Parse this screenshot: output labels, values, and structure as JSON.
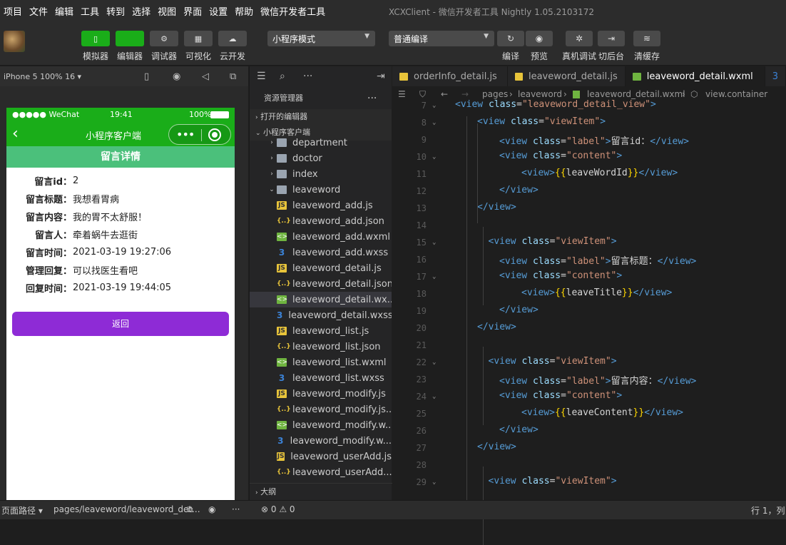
{
  "menu": [
    "项目",
    "文件",
    "编辑",
    "工具",
    "转到",
    "选择",
    "视图",
    "界面",
    "设置",
    "帮助",
    "微信开发者工具"
  ],
  "window_title": "XCXClient - 微信开发者工具 Nightly 1.05.2103172",
  "toolbar": {
    "left_buttons": [
      {
        "label": "模拟器",
        "icon": "phone-icon",
        "active": true
      },
      {
        "label": "编辑器",
        "icon": "code-icon",
        "active": true
      },
      {
        "label": "调试器",
        "icon": "debug-icon",
        "active": false
      },
      {
        "label": "可视化",
        "icon": "layout-icon",
        "active": false
      },
      {
        "label": "云开发",
        "icon": "cloud-icon",
        "active": false
      }
    ],
    "mode_select": "小程序模式",
    "compile_select": "普通编译",
    "right_buttons": [
      {
        "label": "编译",
        "icon": "refresh-icon"
      },
      {
        "label": "预览",
        "icon": "eye-icon"
      },
      {
        "label": "真机调试",
        "icon": "bug-icon"
      },
      {
        "label": "切后台",
        "icon": "switch-icon"
      },
      {
        "label": "清缓存",
        "icon": "layers-icon"
      }
    ]
  },
  "simulator": {
    "device": "iPhone 5 100% 16 ▾",
    "status_left": "●●●●● WeChat",
    "status_time": "19:41",
    "status_battery": "100%",
    "nav_title": "小程序客户端",
    "sub_title": "留言详情",
    "fields": [
      {
        "key": "留言id：",
        "value": "2"
      },
      {
        "key": "留言标题：",
        "value": "我想看胃病"
      },
      {
        "key": "留言内容：",
        "value": "我的胃不太舒服！"
      },
      {
        "key": "留言人：",
        "value": "牵着蜗牛去逛街"
      },
      {
        "key": "留言时间：",
        "value": "2021-03-19 19:27:06"
      },
      {
        "key": "管理回复：",
        "value": "可以找医生看吧"
      },
      {
        "key": "回复时间：",
        "value": "2021-03-19 19:44:05"
      }
    ],
    "back_button": "返回"
  },
  "explorer": {
    "title": "资源管理器",
    "more": "···",
    "open_editors": "打开的编辑器",
    "project": "小程序客户端",
    "items": [
      {
        "name": "department",
        "type": "folder",
        "indent": 1,
        "arrow": "›"
      },
      {
        "name": "doctor",
        "type": "folder",
        "indent": 1,
        "arrow": "›"
      },
      {
        "name": "index",
        "type": "folder",
        "indent": 1,
        "arrow": "›"
      },
      {
        "name": "leaveword",
        "type": "folder",
        "indent": 1,
        "arrow": "⌄"
      },
      {
        "name": "leaveword_add.js",
        "type": "js",
        "indent": 2
      },
      {
        "name": "leaveword_add.json",
        "type": "json",
        "indent": 2
      },
      {
        "name": "leaveword_add.wxml",
        "type": "wxml",
        "indent": 2
      },
      {
        "name": "leaveword_add.wxss",
        "type": "wxss",
        "indent": 2
      },
      {
        "name": "leaveword_detail.js",
        "type": "js",
        "indent": 2
      },
      {
        "name": "leaveword_detail.json",
        "type": "json",
        "indent": 2
      },
      {
        "name": "leaveword_detail.wx...",
        "type": "wxml",
        "indent": 2,
        "selected": true
      },
      {
        "name": "leaveword_detail.wxss",
        "type": "wxss",
        "indent": 2
      },
      {
        "name": "leaveword_list.js",
        "type": "js",
        "indent": 2
      },
      {
        "name": "leaveword_list.json",
        "type": "json",
        "indent": 2
      },
      {
        "name": "leaveword_list.wxml",
        "type": "wxml",
        "indent": 2
      },
      {
        "name": "leaveword_list.wxss",
        "type": "wxss",
        "indent": 2
      },
      {
        "name": "leaveword_modify.js",
        "type": "js",
        "indent": 2
      },
      {
        "name": "leaveword_modify.js...",
        "type": "json",
        "indent": 2
      },
      {
        "name": "leaveword_modify.w...",
        "type": "wxml",
        "indent": 2
      },
      {
        "name": "leaveword_modify.w...",
        "type": "wxss",
        "indent": 2
      },
      {
        "name": "leaveword_userAdd.js",
        "type": "js",
        "indent": 2
      },
      {
        "name": "leaveword_userAdd....",
        "type": "json",
        "indent": 2
      }
    ],
    "outline": "大纲"
  },
  "tabs": [
    {
      "label": "orderInfo_detail.js",
      "type": "js",
      "active": false
    },
    {
      "label": "leaveword_detail.js",
      "type": "js",
      "active": false
    },
    {
      "label": "leaveword_detail.wxml",
      "type": "wxml",
      "active": true
    }
  ],
  "breadcrumb": [
    "pages",
    "leaveword",
    "leaveword_detail.wxml",
    "view.container"
  ],
  "code": [
    {
      "n": "7",
      "i": 0,
      "fold": true,
      "t": [
        [
          "tg",
          "<view "
        ],
        [
          "at",
          "class"
        ],
        [
          "tx",
          "="
        ],
        [
          "st",
          "\"leaveword_detail_view\""
        ],
        [
          "tg",
          ">"
        ]
      ]
    },
    {
      "n": "8",
      "i": 1,
      "fold": true,
      "t": [
        [
          "tg",
          "<view "
        ],
        [
          "at",
          "class"
        ],
        [
          "tx",
          "="
        ],
        [
          "st",
          "\"viewItem\""
        ],
        [
          "tg",
          ">"
        ]
      ]
    },
    {
      "n": "9",
      "i": 2,
      "t": [
        [
          "tg",
          "<view "
        ],
        [
          "at",
          "class"
        ],
        [
          "tx",
          "="
        ],
        [
          "st",
          "\"label\""
        ],
        [
          "tg",
          ">"
        ],
        [
          "tx",
          "留言id："
        ],
        [
          "tg",
          "</view>"
        ]
      ]
    },
    {
      "n": "10",
      "i": 2,
      "fold": true,
      "t": [
        [
          "tg",
          "<view "
        ],
        [
          "at",
          "class"
        ],
        [
          "tx",
          "="
        ],
        [
          "st",
          "\"content\""
        ],
        [
          "tg",
          ">"
        ]
      ]
    },
    {
      "n": "11",
      "i": 3,
      "t": [
        [
          "tg",
          "<view>"
        ],
        [
          "br",
          "{{"
        ],
        [
          "tx",
          "leaveWordId"
        ],
        [
          "br",
          "}}"
        ],
        [
          "tg",
          "</view>"
        ]
      ]
    },
    {
      "n": "12",
      "i": 2,
      "t": [
        [
          "tg",
          "</view>"
        ]
      ]
    },
    {
      "n": "13",
      "i": 1,
      "t": [
        [
          "tg",
          "</view>"
        ]
      ]
    },
    {
      "n": "14",
      "i": 0,
      "t": []
    },
    {
      "n": "15",
      "i": 1.5,
      "fold": true,
      "t": [
        [
          "tg",
          "<view "
        ],
        [
          "at",
          "class"
        ],
        [
          "tx",
          "="
        ],
        [
          "st",
          "\"viewItem\""
        ],
        [
          "tg",
          ">"
        ]
      ]
    },
    {
      "n": "16",
      "i": 2,
      "t": [
        [
          "tg",
          "<view "
        ],
        [
          "at",
          "class"
        ],
        [
          "tx",
          "="
        ],
        [
          "st",
          "\"label\""
        ],
        [
          "tg",
          ">"
        ],
        [
          "tx",
          "留言标题："
        ],
        [
          "tg",
          "</view>"
        ]
      ]
    },
    {
      "n": "17",
      "i": 2,
      "fold": true,
      "t": [
        [
          "tg",
          "<view "
        ],
        [
          "at",
          "class"
        ],
        [
          "tx",
          "="
        ],
        [
          "st",
          "\"content\""
        ],
        [
          "tg",
          ">"
        ]
      ]
    },
    {
      "n": "18",
      "i": 3,
      "t": [
        [
          "tg",
          "<view>"
        ],
        [
          "br",
          "{{"
        ],
        [
          "tx",
          "leaveTitle"
        ],
        [
          "br",
          "}}"
        ],
        [
          "tg",
          "</view>"
        ]
      ]
    },
    {
      "n": "19",
      "i": 2,
      "t": [
        [
          "tg",
          "</view>"
        ]
      ]
    },
    {
      "n": "20",
      "i": 1,
      "t": [
        [
          "tg",
          "</view>"
        ]
      ]
    },
    {
      "n": "21",
      "i": 0,
      "t": []
    },
    {
      "n": "22",
      "i": 1.5,
      "fold": true,
      "t": [
        [
          "tg",
          "<view "
        ],
        [
          "at",
          "class"
        ],
        [
          "tx",
          "="
        ],
        [
          "st",
          "\"viewItem\""
        ],
        [
          "tg",
          ">"
        ]
      ]
    },
    {
      "n": "23",
      "i": 2,
      "t": [
        [
          "tg",
          "<view "
        ],
        [
          "at",
          "class"
        ],
        [
          "tx",
          "="
        ],
        [
          "st",
          "\"label\""
        ],
        [
          "tg",
          ">"
        ],
        [
          "tx",
          "留言内容："
        ],
        [
          "tg",
          "</view>"
        ]
      ]
    },
    {
      "n": "24",
      "i": 2,
      "fold": true,
      "t": [
        [
          "tg",
          "<view "
        ],
        [
          "at",
          "class"
        ],
        [
          "tx",
          "="
        ],
        [
          "st",
          "\"content\""
        ],
        [
          "tg",
          ">"
        ]
      ]
    },
    {
      "n": "25",
      "i": 3,
      "t": [
        [
          "tg",
          "<view>"
        ],
        [
          "br",
          "{{"
        ],
        [
          "tx",
          "leaveContent"
        ],
        [
          "br",
          "}}"
        ],
        [
          "tg",
          "</view>"
        ]
      ]
    },
    {
      "n": "26",
      "i": 2,
      "t": [
        [
          "tg",
          "</view>"
        ]
      ]
    },
    {
      "n": "27",
      "i": 1,
      "t": [
        [
          "tg",
          "</view>"
        ]
      ]
    },
    {
      "n": "28",
      "i": 0,
      "t": []
    },
    {
      "n": "29",
      "i": 1.5,
      "fold": true,
      "t": [
        [
          "tg",
          "<view "
        ],
        [
          "at",
          "class"
        ],
        [
          "tx",
          "="
        ],
        [
          "st",
          "\"viewItem\""
        ],
        [
          "tg",
          ">"
        ]
      ]
    }
  ],
  "statusbar": {
    "path_label": "页面路径 ▾",
    "path": "pages/leaveword/leaveword_det...",
    "errors": "⊗ 0 ⚠ 0",
    "position": "行 1，列"
  }
}
